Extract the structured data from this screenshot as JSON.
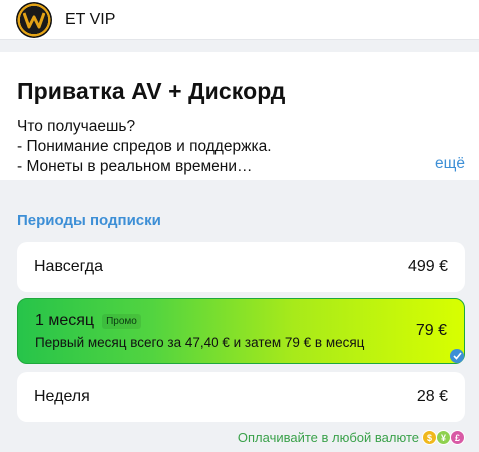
{
  "header": {
    "title": "ET VIP",
    "logo_icon": "brand-logo-icon"
  },
  "product": {
    "title": "Приватка AV + Дискорд",
    "description_lines": [
      "Что получаешь?",
      "- Понимание спредов и поддержка.",
      "- Монеты в реальном времени…"
    ],
    "more_label": "ещё"
  },
  "periods_section": {
    "title": "Периоды подписки",
    "options": [
      {
        "name": "Навсегда",
        "price": "499 €",
        "selected": false
      },
      {
        "name": "1 месяц",
        "badge": "Промо",
        "subtitle": "Первый месяц всего за 47,40 € и затем 79 € в месяц",
        "price": "79 €",
        "selected": true
      },
      {
        "name": "Неделя",
        "price": "28 €",
        "selected": false
      }
    ]
  },
  "payment_note": {
    "text": "Оплачивайте в любой валюте",
    "coins": [
      "$",
      "¥",
      "£"
    ]
  },
  "colors": {
    "accent": "#3d8fd6",
    "promo_gradient_start": "#27c44a",
    "promo_gradient_end": "#d8ff00",
    "pay_note": "#3aa14a"
  }
}
